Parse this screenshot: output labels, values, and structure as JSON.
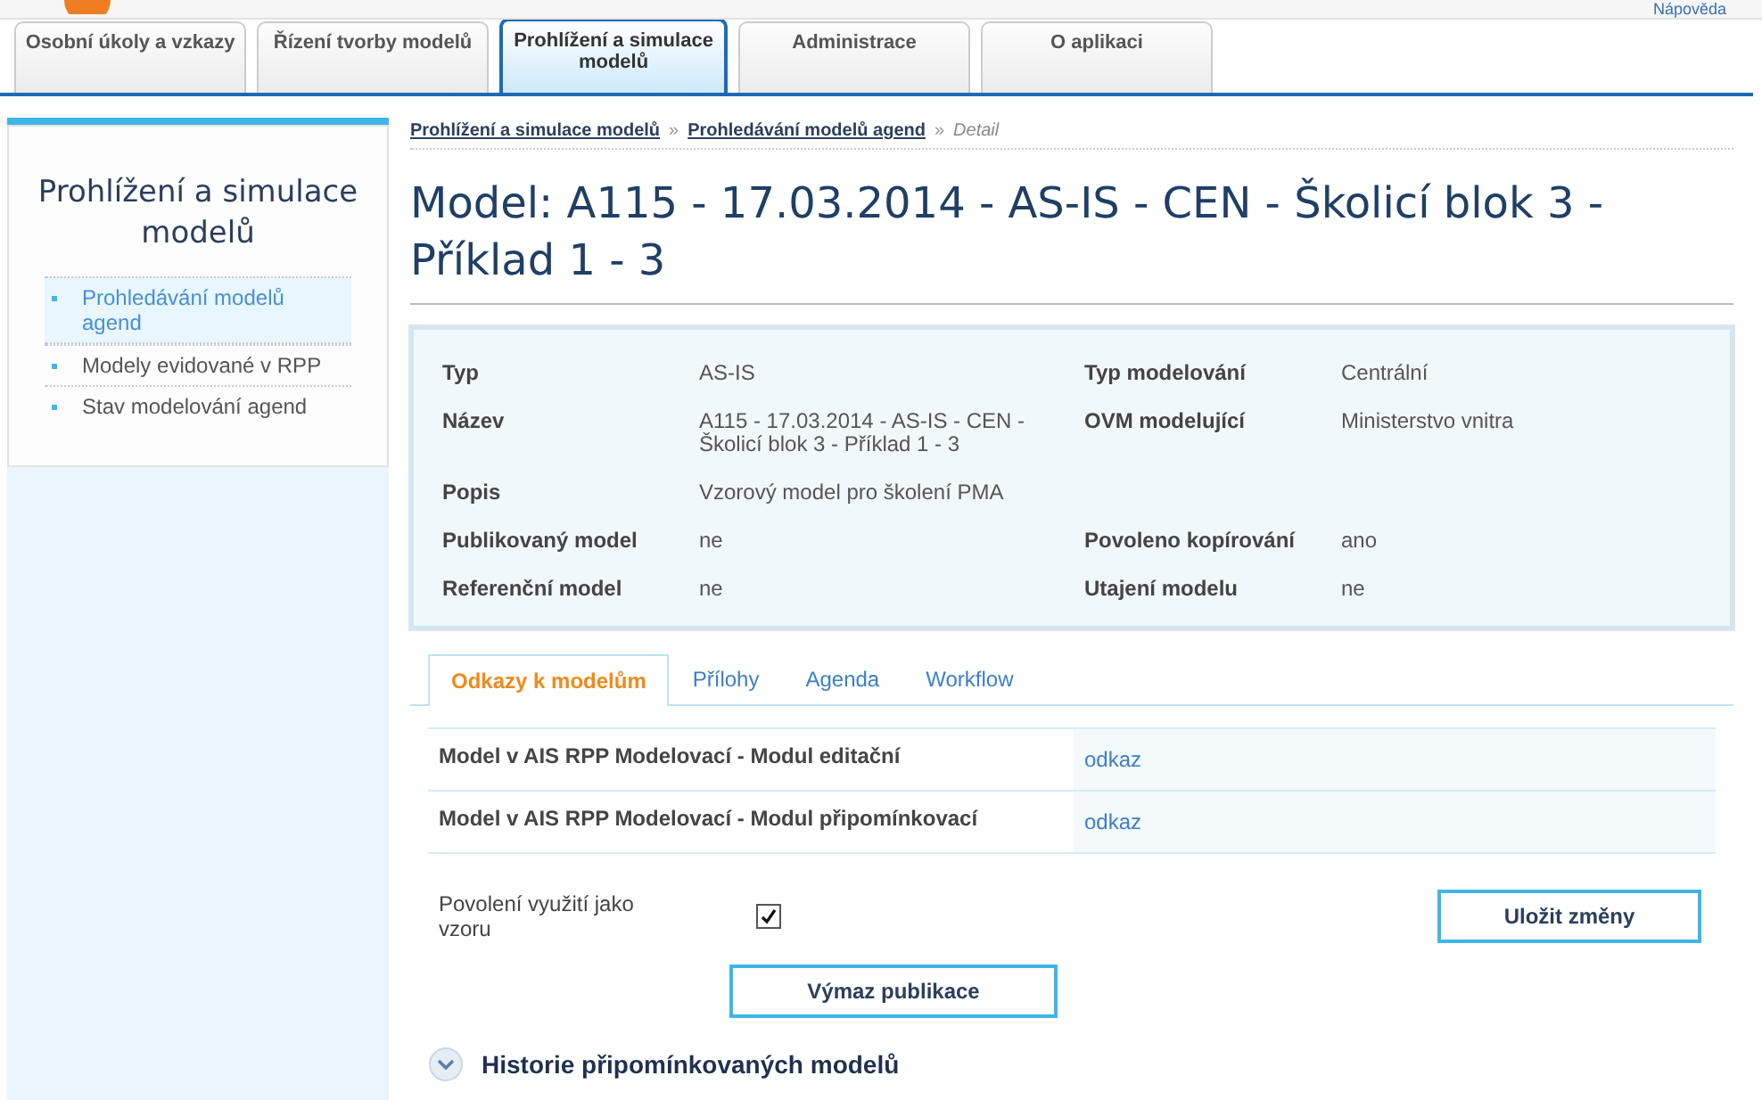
{
  "header": {
    "help_link": "Nápověda"
  },
  "nav_tabs": [
    {
      "label": "Osobní úkoly a vzkazy",
      "selected": false
    },
    {
      "label": "Řízení tvorby modelů",
      "selected": false
    },
    {
      "label": "Prohlížení a simulace modelů",
      "selected": true
    },
    {
      "label": "Administrace",
      "selected": false
    },
    {
      "label": "O aplikaci",
      "selected": false
    }
  ],
  "sidebar": {
    "title": "Prohlížení a simulace modelů",
    "items": [
      {
        "label": "Prohledávání modelů agend",
        "selected": true
      },
      {
        "label": "Modely evidované v RPP",
        "selected": false
      },
      {
        "label": "Stav modelování agend",
        "selected": false
      }
    ]
  },
  "breadcrumb_separator": "»",
  "breadcrumb": [
    {
      "label": "Prohlížení a simulace modelů",
      "kind": "link"
    },
    {
      "label": "Prohledávání modelů agend",
      "kind": "link"
    },
    {
      "label": "Detail",
      "kind": "current"
    }
  ],
  "page_title": "Model: A115 - 17.03.2014 - AS-IS - CEN - Školicí blok 3 - Příklad 1 - 3",
  "details": [
    [
      {
        "label": "Typ",
        "value": "AS-IS"
      },
      {
        "label": "Typ modelování",
        "value": "Centrální"
      }
    ],
    [
      {
        "label": "Název",
        "value": "A115 - 17.03.2014 - AS-IS - CEN - Školicí blok 3 - Příklad 1 - 3"
      },
      {
        "label": "OVM modelující",
        "value": "Ministerstvo vnitra"
      }
    ],
    [
      {
        "label": "Popis",
        "value": "Vzorový model pro školení PMA"
      }
    ],
    [
      {
        "label": "Publikovaný model",
        "value": "ne"
      },
      {
        "label": "Povoleno kopírování",
        "value": "ano"
      }
    ],
    [
      {
        "label": "Referenční model",
        "value": "ne"
      },
      {
        "label": "Utajení modelu",
        "value": "ne"
      }
    ]
  ],
  "content_tabs": [
    {
      "label": "Odkazy k modelům",
      "selected": true
    },
    {
      "label": "Přílohy",
      "selected": false
    },
    {
      "label": "Agenda",
      "selected": false
    },
    {
      "label": "Workflow",
      "selected": false
    }
  ],
  "links_table": [
    {
      "name": "Model v AIS RPP Modelovací - Modul editační",
      "link": "odkaz"
    },
    {
      "name": "Model v AIS RPP Modelovací - Modul připomínkovací",
      "link": "odkaz"
    }
  ],
  "template_permission": {
    "label": "Povolení využití jako vzoru",
    "checked": true
  },
  "buttons": {
    "save": "Uložit změny",
    "delete_publication": "Výmaz publikace"
  },
  "history_section": {
    "title": "Historie připomínkovaných modelů",
    "expanded": false
  }
}
